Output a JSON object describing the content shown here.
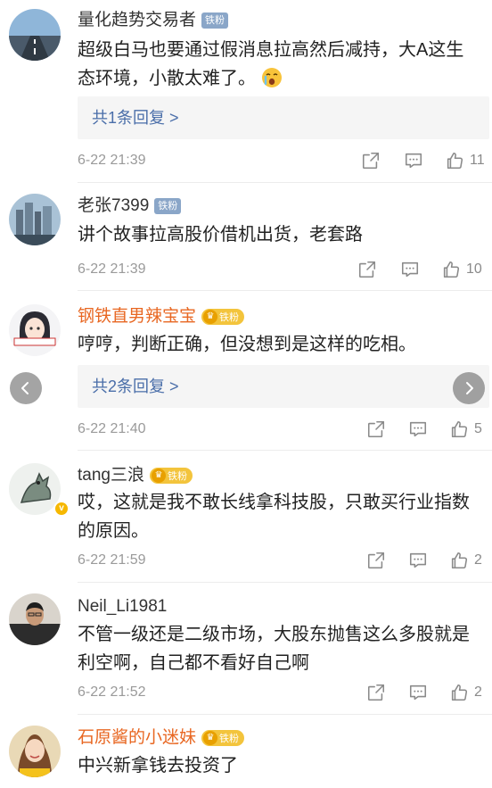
{
  "icons": {
    "share": "share-icon",
    "comment": "comment-icon",
    "like": "thumbs-up-icon"
  },
  "colors": {
    "username_orange": "#e86722",
    "reply_link": "#4a6ea9",
    "fan_badge_blue": "#8aa6c8",
    "fan_badge_gold": "#f3c43c"
  },
  "comments": [
    {
      "username": "量化趋势交易者",
      "fan_badge": "铁粉",
      "text": "超级白马也要通过假消息拉高然后减持，大A这生态环境，小散太难了。",
      "emoji": "crying-face",
      "reply_label": "共1条回复 >",
      "time": "6-22 21:39",
      "likes": "11"
    },
    {
      "username": "老张7399",
      "fan_badge": "铁粉",
      "text": "讲个故事拉高股价借机出货，老套路",
      "time": "6-22 21:39",
      "likes": "10"
    },
    {
      "username": "钢铁直男辣宝宝",
      "fan_badge": "铁粉",
      "text": "哼哼，判断正确，但没想到是这样的吃相。",
      "reply_label": "共2条回复 >",
      "time": "6-22 21:40",
      "likes": "5"
    },
    {
      "username": "tang三浪",
      "fan_badge": "铁粉",
      "text": "哎，这就是我不敢长线拿科技股，只敢买行业指数的原因。",
      "time": "6-22 21:59",
      "likes": "2"
    },
    {
      "username": "Neil_Li1981",
      "text": "不管一级还是二级市场，大股东抛售这么多股就是利空啊，自己都不看好自己啊",
      "time": "6-22 21:52",
      "likes": "2"
    },
    {
      "username": "石原酱的小迷妹",
      "fan_badge": "铁粉",
      "text": "中兴新拿钱去投资了"
    }
  ]
}
